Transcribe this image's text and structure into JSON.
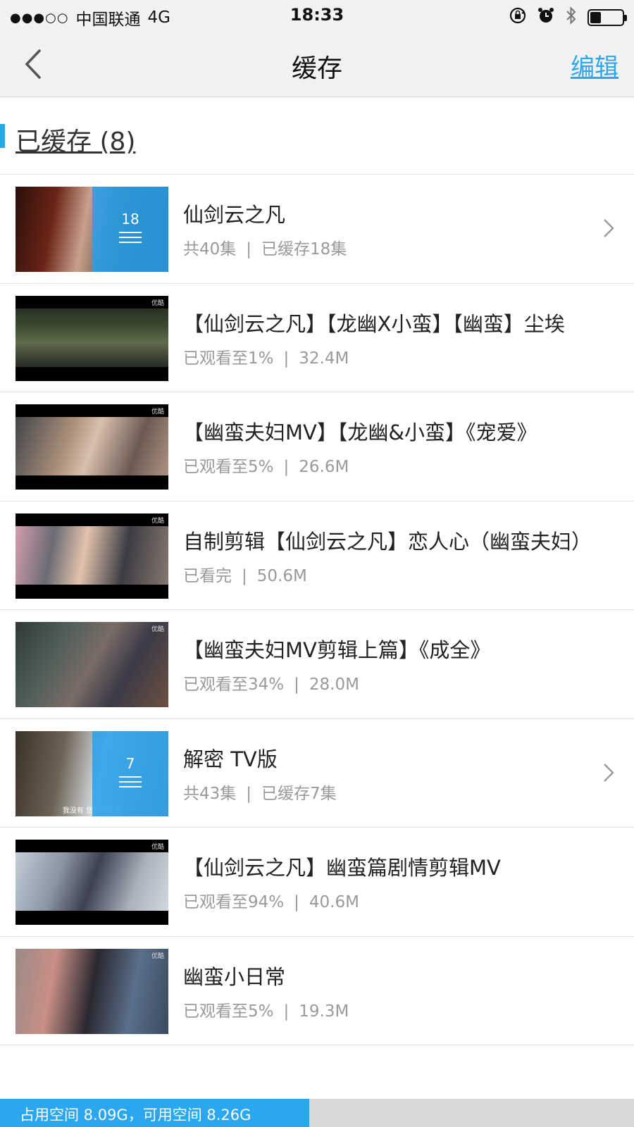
{
  "status_bar": {
    "signal": "●●●○○",
    "carrier": "中国联通",
    "network": "4G",
    "time": "18:33",
    "battery_level": 0.35
  },
  "nav": {
    "title": "缓存",
    "edit_label": "编辑"
  },
  "section": {
    "title": "已缓存 (8)"
  },
  "items": [
    {
      "title": "仙剑云之凡",
      "meta_left": "共40集",
      "meta_sep": "|",
      "meta_right": "已缓存18集",
      "folder_count": "18",
      "is_folder": true
    },
    {
      "title": "【仙剑云之凡】【龙幽X小蛮】【幽蛮】尘埃",
      "meta_left": "已观看至1%",
      "meta_sep": "|",
      "meta_right": "32.4M",
      "wm": "优酷"
    },
    {
      "title": "【幽蛮夫妇MV】【龙幽&小蛮】《宠爱》",
      "meta_left": "已观看至5%",
      "meta_sep": "|",
      "meta_right": "26.6M",
      "wm": "优酷"
    },
    {
      "title": "自制剪辑【仙剑云之凡】恋人心（幽蛮夫妇）",
      "meta_left": "已看完",
      "meta_sep": "|",
      "meta_right": "50.6M",
      "wm": "优酷"
    },
    {
      "title": "【幽蛮夫妇MV剪辑上篇】《成全》",
      "meta_left": "已观看至34%",
      "meta_sep": "|",
      "meta_right": "28.0M",
      "wm": "优酷"
    },
    {
      "title": "解密 TV版",
      "meta_left": "共43集",
      "meta_sep": "|",
      "meta_right": "已缓存7集",
      "folder_count": "7",
      "is_folder": true,
      "caption": "我没有 您别开玩笑"
    },
    {
      "title": "【仙剑云之凡】幽蛮篇剧情剪辑MV",
      "meta_left": "已观看至94%",
      "meta_sep": "|",
      "meta_right": "40.6M",
      "wm": "优酷"
    },
    {
      "title": "幽蛮小日常",
      "meta_left": "已观看至5%",
      "meta_sep": "|",
      "meta_right": "19.3M",
      "wm": "优酷"
    }
  ],
  "footer": {
    "storage_text": "占用空间 8.09G，可用空间 8.26G",
    "used_fraction": 0.488
  },
  "colors": {
    "accent": "#2aa7ef",
    "edit": "#30a6e8",
    "meta": "#9a9a9a"
  }
}
